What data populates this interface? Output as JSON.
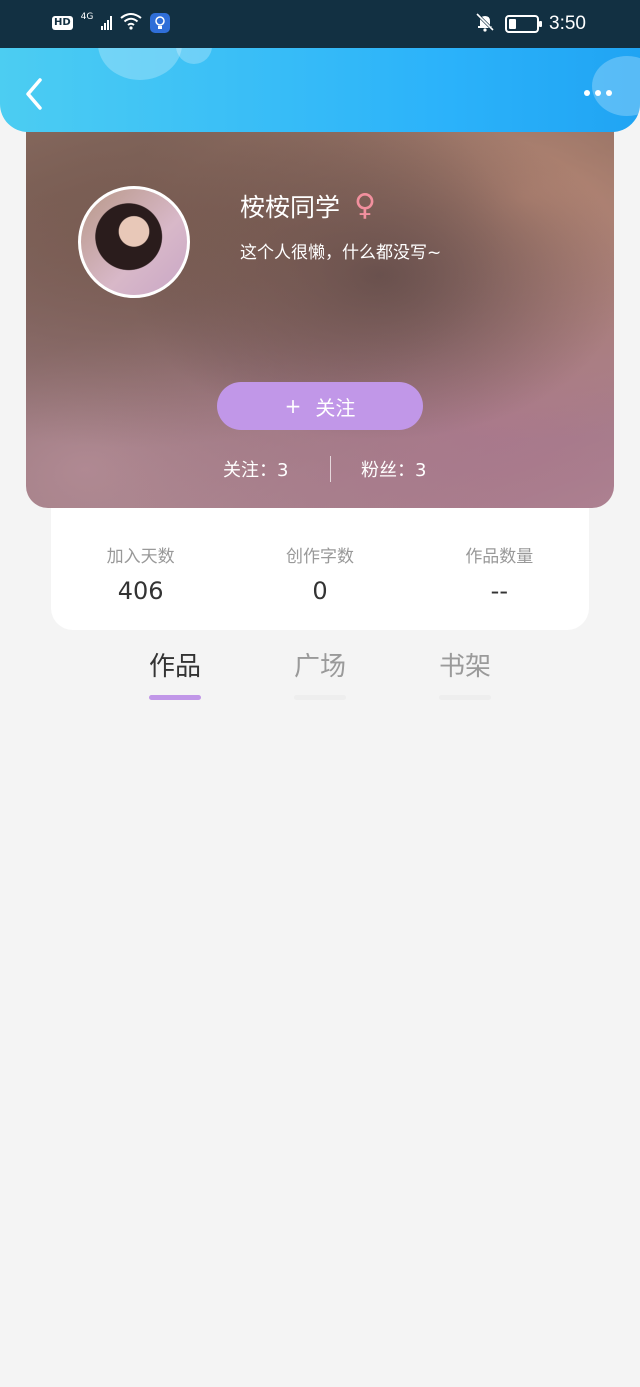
{
  "status_bar": {
    "hd_label": "HD",
    "network_label": "4G",
    "time": "3:50",
    "icons": [
      "hd-icon",
      "signal-icon",
      "wifi-icon",
      "lightbulb-icon",
      "bell-muted-icon",
      "battery-icon"
    ]
  },
  "header": {
    "back_icon": "chevron-left-icon",
    "more_icon": "more-dots-icon",
    "colors": {
      "gradient_start": "#4ccdf2",
      "gradient_end": "#20a4f3"
    }
  },
  "profile": {
    "username": "桉桉同学",
    "gender_symbol": "♀",
    "bio": "这个人很懒，什么都没写~",
    "follow_button": {
      "plus": "+",
      "label": "关注"
    },
    "following_label": "关注：3",
    "followers_label": "粉丝：3",
    "accent_color": "#c197e8"
  },
  "stats": [
    {
      "label": "加入天数",
      "value": "406"
    },
    {
      "label": "创作字数",
      "value": "0"
    },
    {
      "label": "作品数量",
      "value": "--"
    }
  ],
  "tabs": [
    {
      "label": "作品",
      "active": true
    },
    {
      "label": "广场",
      "active": false
    },
    {
      "label": "书架",
      "active": false
    }
  ]
}
